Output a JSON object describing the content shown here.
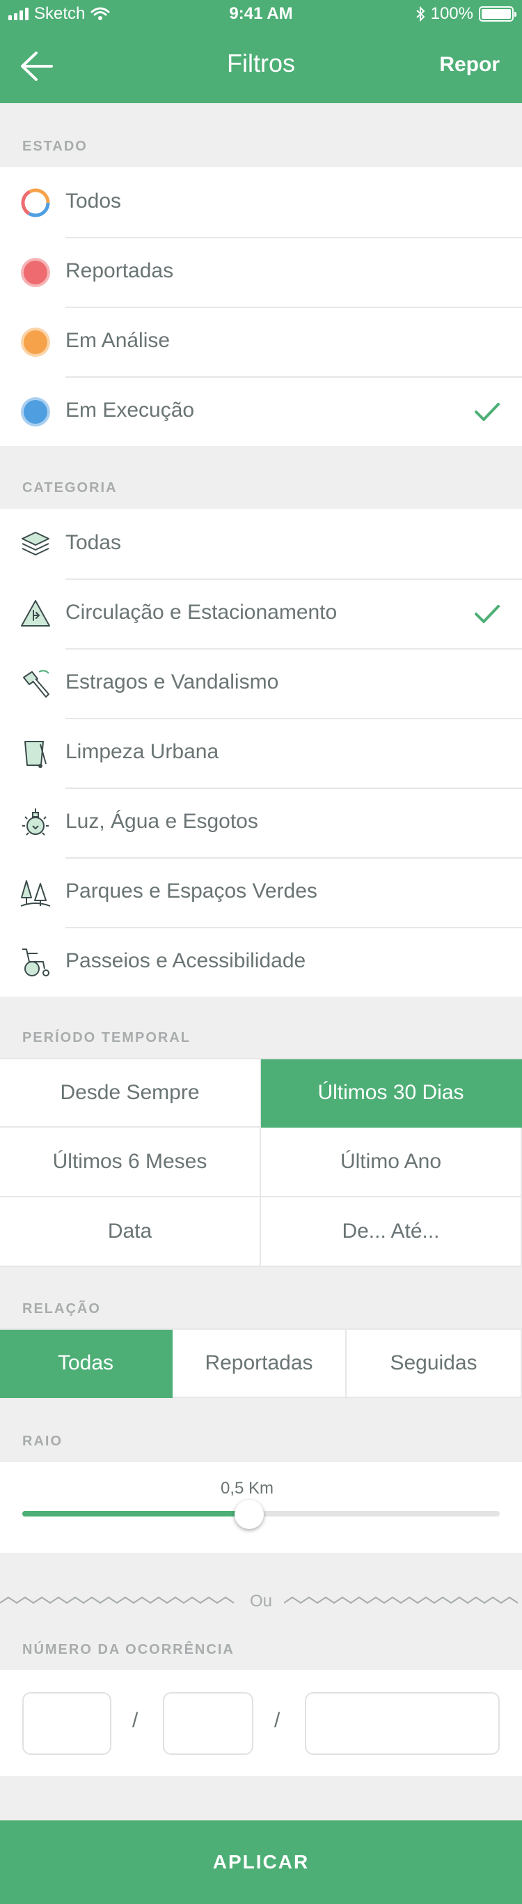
{
  "status_bar": {
    "carrier": "Sketch",
    "time": "9:41 AM",
    "battery": "100%"
  },
  "nav": {
    "title": "Filtros",
    "reset": "Repor"
  },
  "estado": {
    "header": "ESTADO",
    "items": [
      {
        "label": "Todos",
        "icon": "multicolor-ring-icon",
        "color": "#4f9fe0",
        "checked": false
      },
      {
        "label": "Reportadas",
        "icon": "red-dot-icon",
        "color": "#ee6b70",
        "checked": false
      },
      {
        "label": "Em Análise",
        "icon": "orange-dot-icon",
        "color": "#f5a24a",
        "checked": false
      },
      {
        "label": "Em Execução",
        "icon": "blue-dot-icon",
        "color": "#4f9fe0",
        "checked": true
      }
    ]
  },
  "categoria": {
    "header": "CATEGORIA",
    "items": [
      {
        "label": "Todas",
        "icon": "layers-icon",
        "checked": false
      },
      {
        "label": "Circulação e Estacionamento",
        "icon": "traffic-sign-icon",
        "checked": true
      },
      {
        "label": "Estragos e Vandalismo",
        "icon": "hammer-icon",
        "checked": false
      },
      {
        "label": "Limpeza Urbana",
        "icon": "trash-bin-icon",
        "checked": false
      },
      {
        "label": "Luz, Água e Esgotos",
        "icon": "light-bulb-icon",
        "checked": false
      },
      {
        "label": "Parques e Espaços Verdes",
        "icon": "trees-icon",
        "checked": false
      },
      {
        "label": "Passeios e Acessibilidade",
        "icon": "wheelchair-icon",
        "checked": false
      }
    ]
  },
  "periodo": {
    "header": "PERÍODO TEMPORAL",
    "options": [
      "Desde Sempre",
      "Últimos 30 Dias",
      "Últimos 6 Meses",
      "Último Ano",
      "Data",
      "De... Até..."
    ],
    "selected": "Últimos 30 Dias"
  },
  "relacao": {
    "header": "RELAÇÃO",
    "options": [
      "Todas",
      "Reportadas",
      "Seguidas"
    ],
    "selected": "Todas"
  },
  "raio": {
    "header": "RAIO",
    "value_label": "0,5 Km",
    "fraction": 0.475
  },
  "divider": {
    "ou": "Ou"
  },
  "ocorrencia": {
    "header": "NÚMERO DA OCORRÊNCIA",
    "slash": "/"
  },
  "apply": {
    "label": "APLICAR"
  },
  "colors": {
    "accent": "#4daf76",
    "background": "#efefef"
  }
}
